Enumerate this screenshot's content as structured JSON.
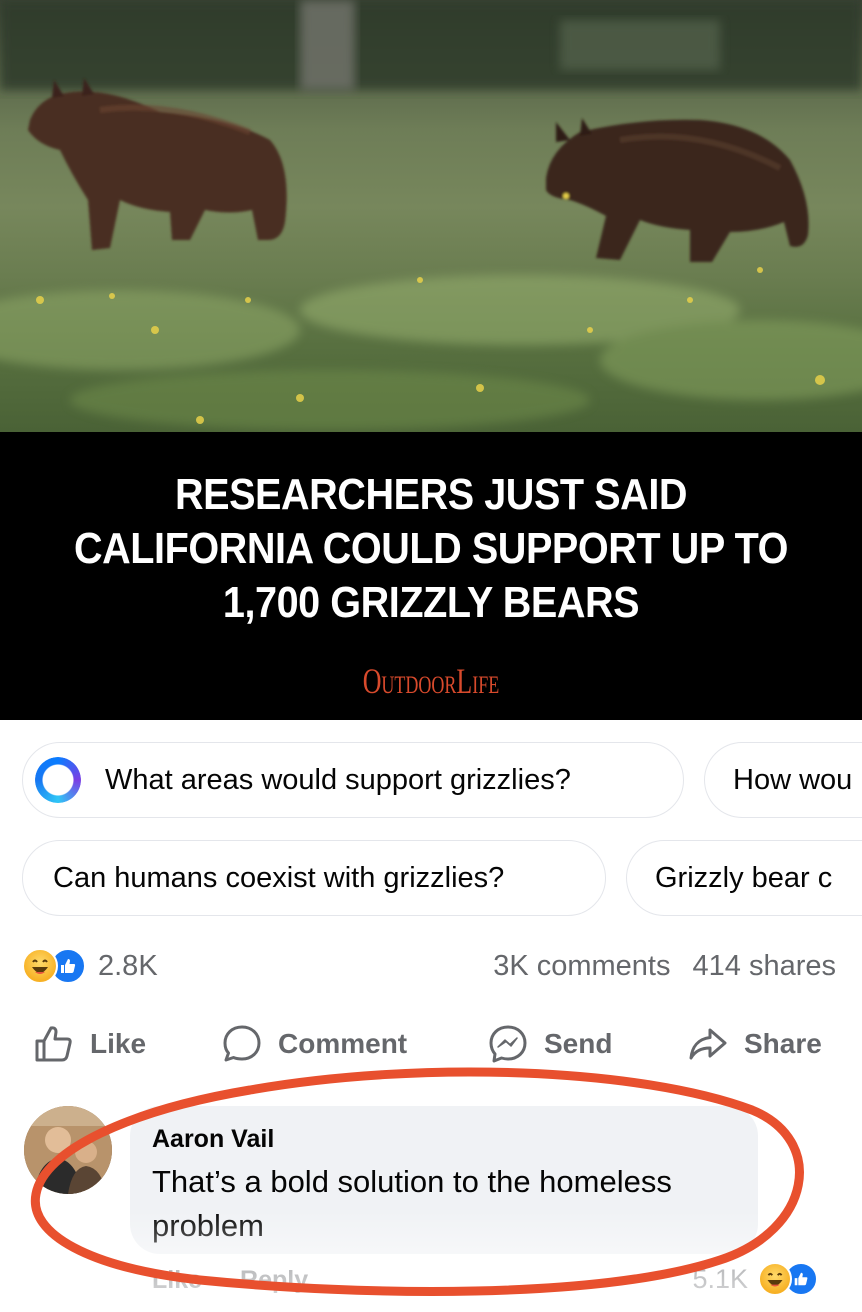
{
  "post": {
    "photo_alt": "Two grizzly bears walking through a meadow",
    "headline": "RESEARCHERS JUST SAID CALIFORNIA COULD SUPPORT UP TO 1,700 GRIZZLY BEARS",
    "publisher": "OUTDOOR LIFE"
  },
  "suggestions": [
    "What areas would support grizzlies?",
    "How wou",
    "Can humans coexist with grizzlies?",
    "Grizzly bear c"
  ],
  "stats": {
    "reaction_count": "2.8K",
    "comments": "3K comments",
    "shares": "414 shares"
  },
  "actions": {
    "like": "Like",
    "comment": "Comment",
    "send": "Send",
    "share": "Share"
  },
  "comment": {
    "author": "Aaron Vail",
    "text": "That’s a bold solution to the homeless problem",
    "like": "Like",
    "reply": "Reply",
    "reaction_count": "5.1K"
  },
  "colors": {
    "publisher": "#d84a2c",
    "facebook_blue": "#1877f2",
    "annotation_circle": "#e8502e",
    "muted_text": "#65676b"
  },
  "icons": {
    "suggestion": "meta-ai-ring-icon",
    "reactions": [
      "haha-reaction-icon",
      "like-reaction-icon"
    ],
    "actions": [
      "thumbs-up-icon",
      "comment-bubble-icon",
      "messenger-icon",
      "share-arrow-icon"
    ]
  }
}
